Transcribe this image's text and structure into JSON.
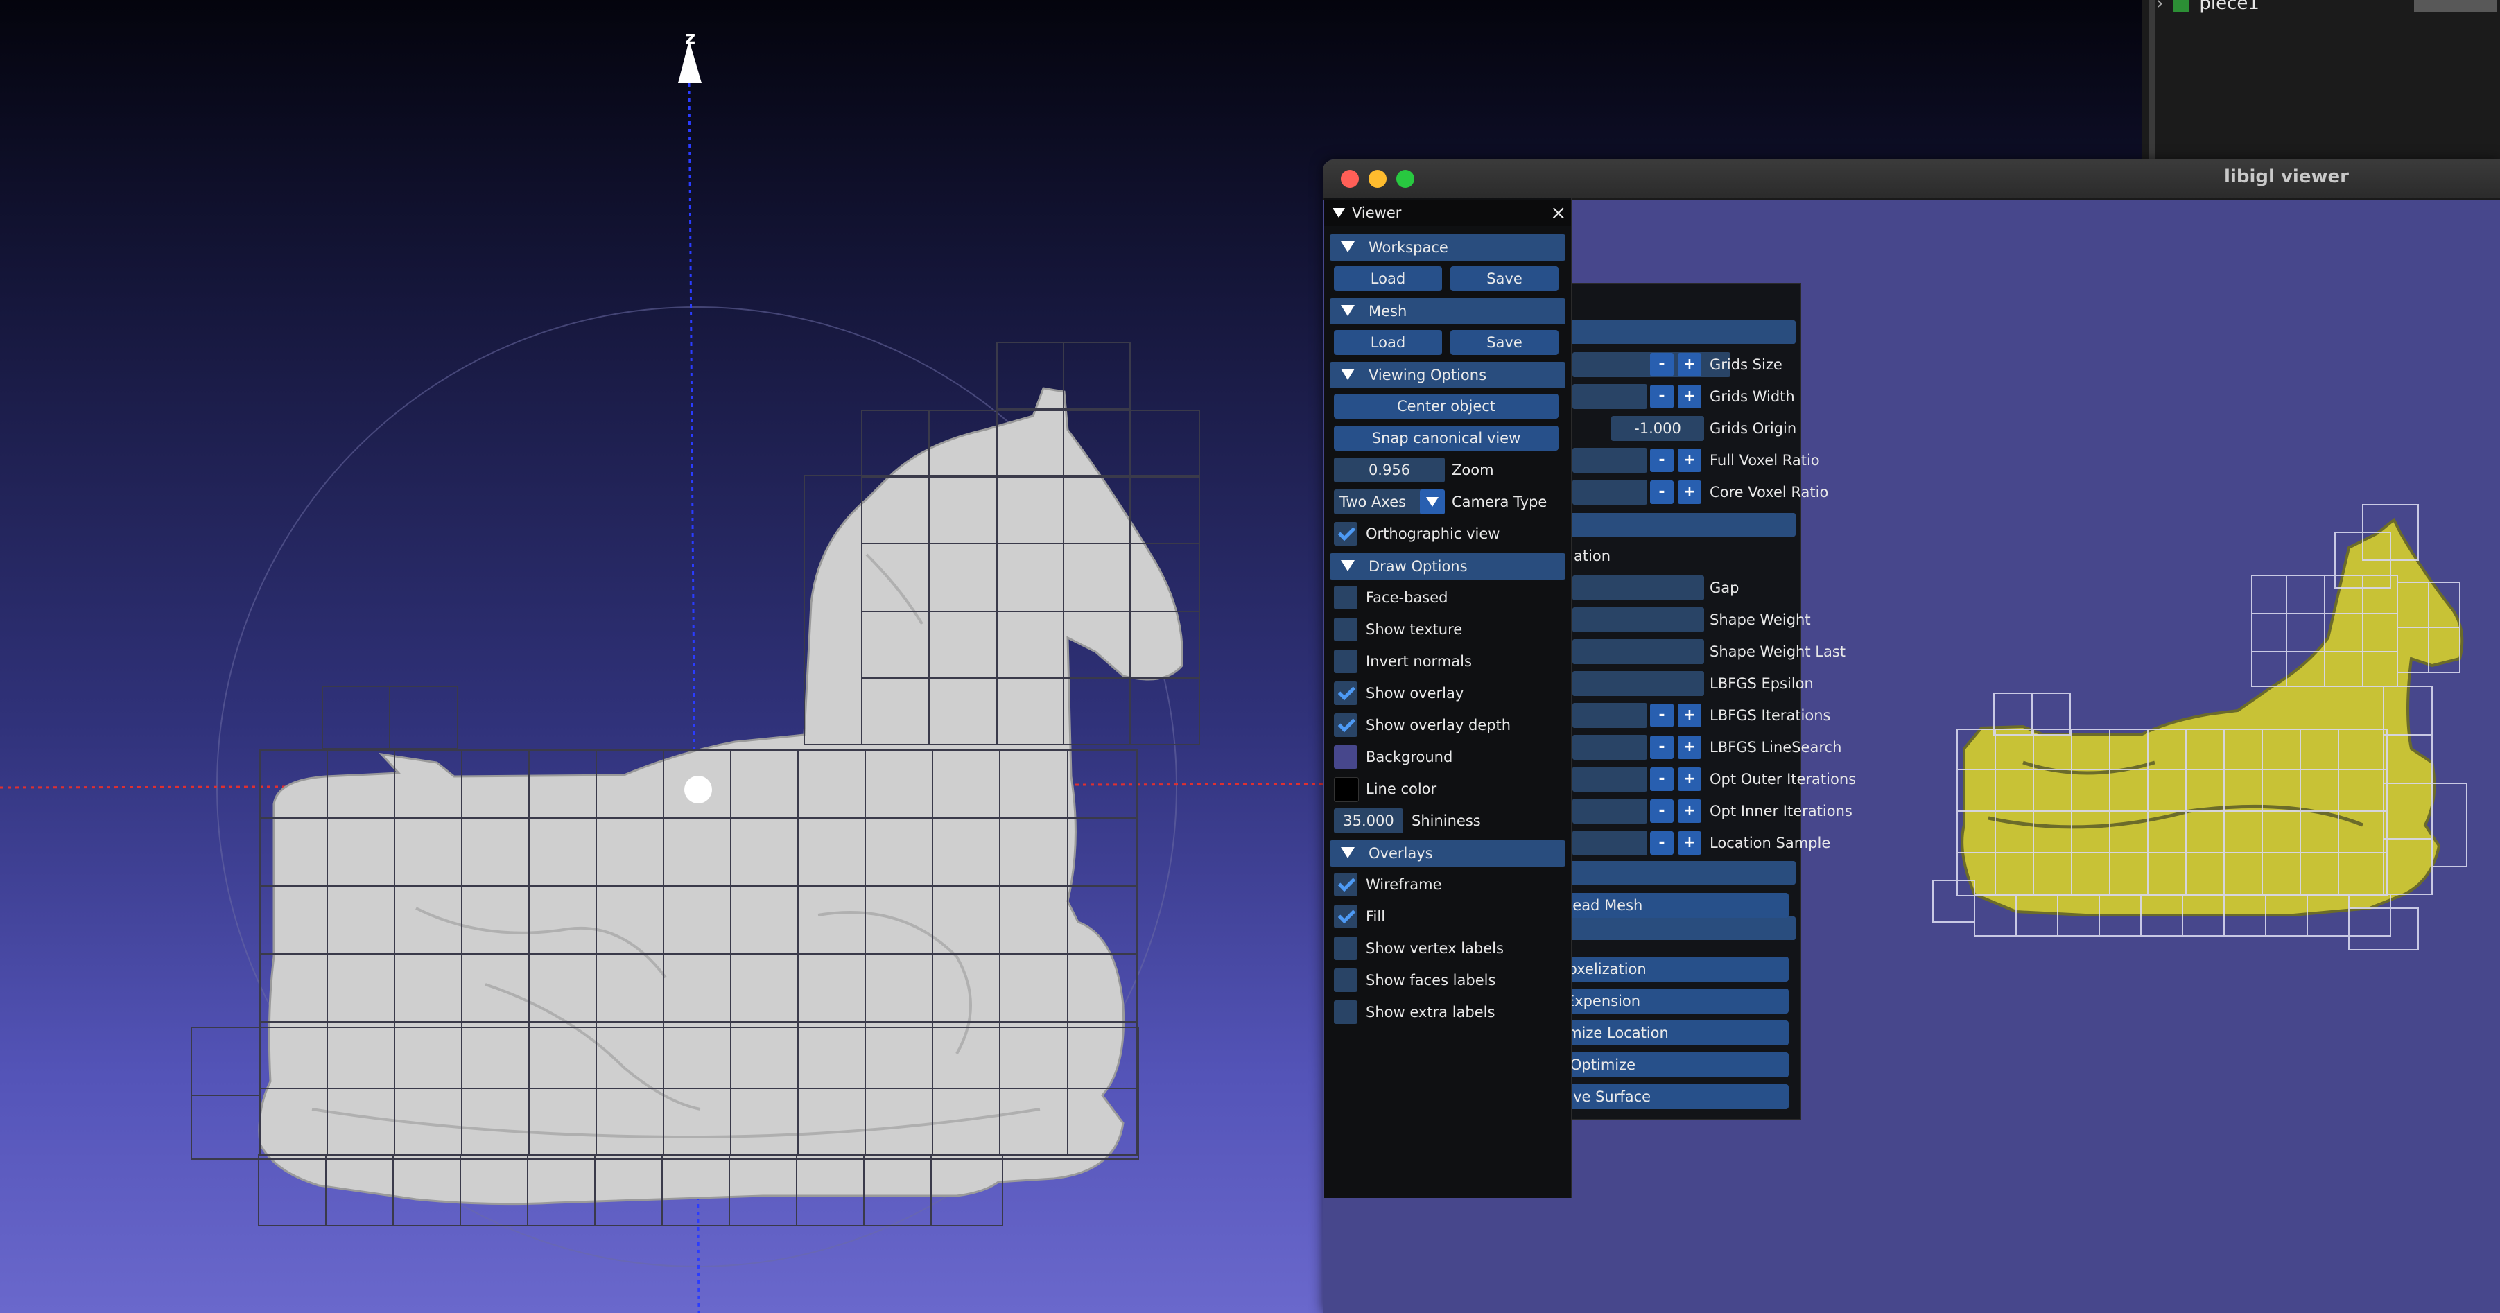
{
  "main_view": {
    "axis_z_label": "z"
  },
  "outliner": {
    "item_label": "piece1"
  },
  "window": {
    "title": "libigl viewer"
  },
  "viewer_menu": {
    "title": "Viewer",
    "close_glyph": "×",
    "workspace": {
      "label": "Workspace",
      "load": "Load",
      "save": "Save"
    },
    "mesh": {
      "label": "Mesh",
      "load": "Load",
      "save": "Save"
    },
    "viewing_options": {
      "label": "Viewing Options",
      "center_object": "Center object",
      "snap_canonical": "Snap canonical view",
      "zoom_value": "0.956",
      "zoom_label": "Zoom",
      "camera_type_value": "Two Axes",
      "camera_type_label": "Camera Type",
      "orthographic_label": "Orthographic view",
      "orthographic_checked": true
    },
    "draw_options": {
      "label": "Draw Options",
      "face_based": "Face-based",
      "show_texture": "Show texture",
      "invert_normals": "Invert normals",
      "show_overlay": "Show overlay",
      "show_overlay_depth": "Show overlay depth",
      "background": "Background",
      "background_color": "#47478c",
      "line_color": "Line color",
      "line_color_value": "#000000",
      "shininess_value": "35.000",
      "shininess_label": "Shininess"
    },
    "overlays": {
      "label": "Overlays",
      "wireframe": "Wireframe",
      "fill": "Fill",
      "show_vertex_labels": "Show vertex labels",
      "show_faces_labels": "Show faces labels",
      "show_extra_labels": "Show extra labels"
    }
  },
  "tool_panel": {
    "grids_size": "Grids Size",
    "grids_width": "Grids Width",
    "grids_origin_value": "-1.000",
    "grids_origin": "Grids Origin",
    "full_voxel_ratio": "Full Voxel Ratio",
    "core_voxel_ratio": "Core Voxel Ratio",
    "section_fragment": "ation",
    "gap": "Gap",
    "shape_weight": "Shape Weight",
    "shape_weight_last": "Shape Weight Last",
    "lbfgs_epsilon": "LBFGS Epsilon",
    "lbfgs_iterations": "LBFGS Iterations",
    "lbfgs_linesearch": "LBFGS LineSearch",
    "opt_outer_iterations": "Opt Outer Iterations",
    "opt_inner_iterations": "Opt Inner Iterations",
    "location_sample": "Location Sample",
    "minus": "-",
    "plus": "+",
    "buttons": {
      "read_mesh": "Read Mesh",
      "voxelization": "Voxelization",
      "expension": "Expension",
      "optimize_location": "Optimize Location",
      "optimize": "Optimize",
      "save_surface": "Save Surface"
    }
  }
}
